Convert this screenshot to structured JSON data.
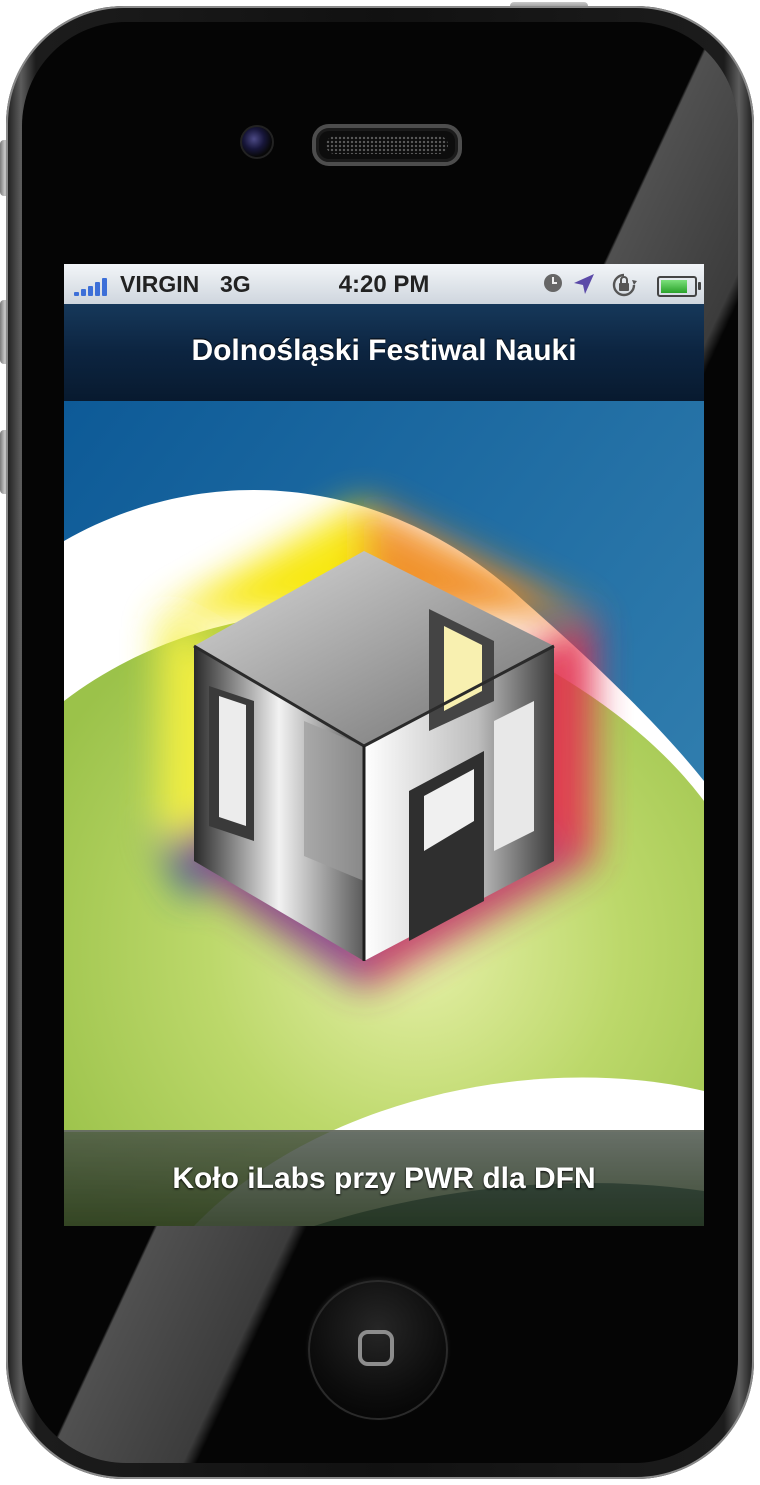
{
  "status_bar": {
    "carrier": "VIRGIN",
    "network": "3G",
    "time": "4:20 PM",
    "signal_bars": 5,
    "icons": [
      "clock-icon",
      "location-arrow-icon",
      "rotation-lock-icon",
      "battery-icon"
    ],
    "battery_level": 0.85,
    "signal_color": "#3d6fd8"
  },
  "navbar": {
    "title": "Dolnośląski Festiwal Nauki"
  },
  "logo": {
    "name": "DFN cube logo",
    "colors": [
      "#f7e600",
      "#f08a1e",
      "#e2334f",
      "#8a3e8e",
      "#35609a"
    ]
  },
  "footer": {
    "text": "Koło iLabs przy PWR dla DFN"
  },
  "device": {
    "home_button": "home-button"
  }
}
